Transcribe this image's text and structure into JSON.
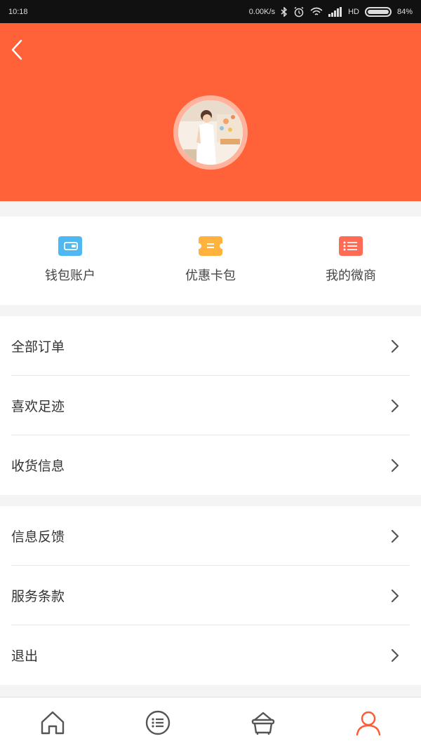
{
  "status_bar": {
    "time": "10:18",
    "network_speed": "0.00K/s",
    "network_type": "HD",
    "battery": "84%",
    "icons": [
      "bluetooth-icon",
      "alarm-icon",
      "wifi-icon",
      "signal-icon",
      "battery-icon"
    ]
  },
  "header": {
    "background_color": "#ff6138",
    "back_icon": "chevron-left-icon",
    "avatar_alt": "user-avatar"
  },
  "quick_actions": [
    {
      "label": "钱包账户",
      "icon": "wallet-icon",
      "color": "#4fb8f0"
    },
    {
      "label": "优惠卡包",
      "icon": "coupon-icon",
      "color": "#ffb23d"
    },
    {
      "label": "我的微商",
      "icon": "shop-list-icon",
      "color": "#ff6b55"
    }
  ],
  "menu_group_1": [
    {
      "label": "全部订单"
    },
    {
      "label": "喜欢足迹"
    },
    {
      "label": "收货信息"
    }
  ],
  "menu_group_2": [
    {
      "label": "信息反馈"
    },
    {
      "label": "服务条款"
    },
    {
      "label": "退出"
    }
  ],
  "bottom_nav": {
    "items": [
      "home-icon",
      "category-list-icon",
      "cart-basket-icon",
      "profile-icon"
    ],
    "active_index": 3,
    "active_color": "#ff5a33",
    "inactive_color": "#555555"
  }
}
